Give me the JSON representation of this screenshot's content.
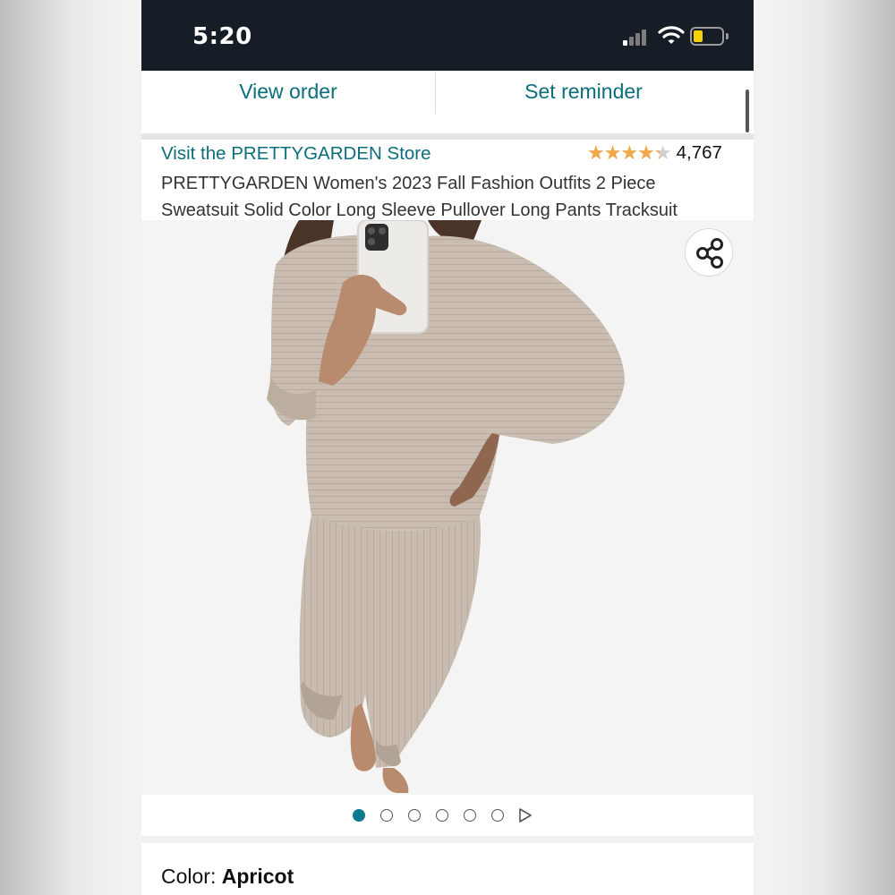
{
  "status_bar": {
    "time": "5:20",
    "icons": [
      "cellular-signal-icon",
      "wifi-icon",
      "battery-icon"
    ],
    "battery_color": "#f5d300"
  },
  "actions": {
    "view_order": "View order",
    "set_reminder": "Set reminder"
  },
  "product": {
    "store_link": "Visit the PRETTYGARDEN Store",
    "rating_stars": 4.3,
    "rating_max": 5,
    "rating_count": "4,767",
    "title": "PRETTYGARDEN Women's 2023 Fall Fashion Outfits 2 Piece Sweatsuit Solid Color Long Sleeve Pullover Long Pants Tracksuit"
  },
  "gallery": {
    "image_count": 6,
    "active_index": 0,
    "icons": [
      "share-icon",
      "play-video-icon"
    ]
  },
  "variation": {
    "label": "Color: ",
    "value": "Apricot"
  },
  "colors": {
    "link": "#0b6e7b",
    "star": "#f3a847",
    "active_dot": "#0b7a8c",
    "status_bar_bg": "#161d26"
  }
}
